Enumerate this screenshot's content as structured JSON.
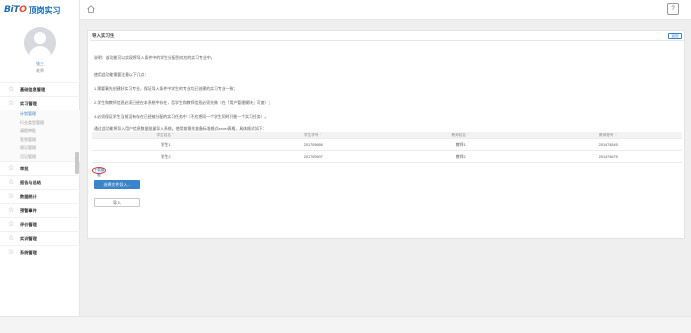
{
  "brand": {
    "logo_mark_left": "BiT",
    "logo_mark_right": "O",
    "logo_text": "顶岗实习"
  },
  "user": {
    "name": "张三",
    "role": "老师"
  },
  "sidebar": {
    "items": [
      {
        "label": "基础信息管理"
      },
      {
        "label": "实习管理"
      },
      {
        "label": "审批"
      },
      {
        "label": "报告与总结"
      },
      {
        "label": "数据统计"
      },
      {
        "label": "预警事件"
      },
      {
        "label": "评价管理"
      },
      {
        "label": "实训管理"
      },
      {
        "label": "系统管理"
      }
    ],
    "submenu": [
      "计划管理",
      "行业类型管理",
      "请假审批",
      "签到管理",
      "周记管理",
      "月记管理"
    ]
  },
  "topbar": {
    "help_label": "?"
  },
  "page": {
    "title": "导入实习生",
    "back_label": "返回",
    "paragraphs": [
      "说明：该功能可以实现将导入条件中的学生分配到对应的实习专业中。",
      "使用此功能需要注意以下几点：",
      "1.需要事先创建好实习专业，保证导入条件中学生的专业均已创建的实习专业一致；",
      "2.学生和教师信息必须已经在本系统中存在，否学生和教师信息必须先做（在「用户管理模块」可查）；",
      "3.必须保证学生当前没有存在已经被分配的实习任务中（不应把同一个学生同时只能一个实习任务）。",
      "通过此功能将导入用户信息数据批量导入系统。使用前需先准备标准格式excel表格，具体格式如下："
    ],
    "table": {
      "headers": [
        "学生姓名",
        "学生学号",
        "教师姓名",
        "教师账号"
      ],
      "rows": [
        [
          "学生1",
          "201709666",
          "教师1",
          "201474545"
        ],
        [
          "学生2",
          "201709907",
          "教师2",
          "201474675"
        ]
      ]
    },
    "download_label": "下载模板",
    "choose_label": "选择文件导入...",
    "import_label": "导入"
  },
  "colors": {
    "accent": "#3b84c9",
    "highlight_circle": "#e33333"
  }
}
